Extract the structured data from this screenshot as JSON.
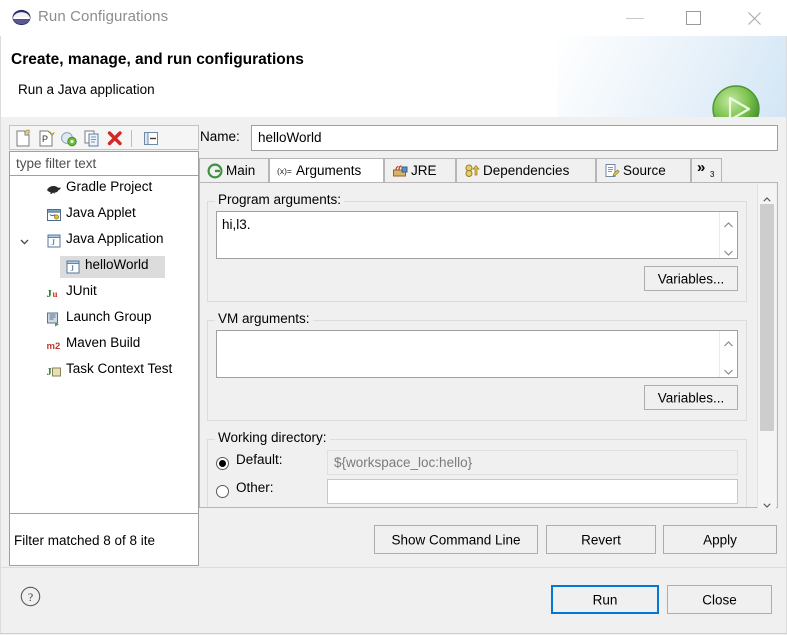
{
  "window": {
    "title": "Run Configurations",
    "app_icon": "eclipse-icon",
    "controls": {
      "minimize": "minimize-icon",
      "maximize": "maximize-icon",
      "close": "close-icon"
    }
  },
  "header": {
    "title": "Create, manage, and run configurations",
    "subtitle": "Run a Java application",
    "banner_icon": "run-green-play-icon"
  },
  "left_panel": {
    "toolbar": [
      {
        "name": "new-launch-configuration",
        "icon": "new-file-icon"
      },
      {
        "name": "new-prototype",
        "icon": "new-prototype-icon"
      },
      {
        "name": "export",
        "icon": "export-icon"
      },
      {
        "name": "duplicate",
        "icon": "duplicate-icon"
      },
      {
        "name": "delete",
        "icon": "delete-red-x-icon"
      },
      {
        "name": "collapse-all",
        "icon": "collapse-all-icon"
      }
    ],
    "filter": {
      "placeholder": "type filter text",
      "value": ""
    },
    "tree": [
      {
        "label": "Gradle Project",
        "icon": "gradle-elephant-icon",
        "indent": 0,
        "twisty": "none",
        "selected": false
      },
      {
        "label": "Java Applet",
        "icon": "java-applet-icon",
        "indent": 0,
        "twisty": "none",
        "selected": false
      },
      {
        "label": "Java Application",
        "icon": "java-application-icon",
        "indent": 0,
        "twisty": "expanded",
        "selected": false
      },
      {
        "label": "helloWorld",
        "icon": "java-application-icon",
        "indent": 1,
        "twisty": "none",
        "selected": true
      },
      {
        "label": "JUnit",
        "icon": "junit-icon",
        "indent": 0,
        "twisty": "none",
        "selected": false
      },
      {
        "label": "Launch Group",
        "icon": "launch-group-icon",
        "indent": 0,
        "twisty": "none",
        "selected": false
      },
      {
        "label": "Maven Build",
        "icon": "maven-m2-icon",
        "indent": 0,
        "twisty": "none",
        "selected": false
      },
      {
        "label": "Task Context Test",
        "icon": "task-context-test-icon",
        "indent": 0,
        "twisty": "none",
        "selected": false
      }
    ],
    "status": "Filter matched 8 of 8 ite"
  },
  "right_panel": {
    "name_label": "Name:",
    "name_value": "helloWorld",
    "name_placeholder": "",
    "tabs": [
      {
        "label": "Main",
        "icon": "main-green-c-icon",
        "active": false
      },
      {
        "label": "Arguments",
        "icon": "arguments-icon",
        "active": true
      },
      {
        "label": "JRE",
        "icon": "jre-icon",
        "active": false
      },
      {
        "label": "Dependencies",
        "icon": "dependencies-icon",
        "active": false
      },
      {
        "label": "Source",
        "icon": "source-icon",
        "active": false
      }
    ],
    "tab_overflow": {
      "label": "»",
      "count": "3"
    },
    "arguments_tab": {
      "program_arguments": {
        "label": "Program arguments:",
        "value": "hi,l3.",
        "variables_button": "Variables..."
      },
      "vm_arguments": {
        "label": "VM arguments:",
        "value": "",
        "variables_button": "Variables..."
      },
      "working_directory": {
        "label": "Working directory:",
        "default_radio_label": "Default:",
        "default_value": "${workspace_loc:hello}",
        "default_selected": true,
        "other_radio_label": "Other:",
        "other_value": ""
      }
    },
    "action_buttons": {
      "show_command_line": "Show Command Line",
      "revert": "Revert",
      "apply": "Apply"
    }
  },
  "footer": {
    "help_icon": "help-question-icon",
    "run_button": "Run",
    "close_button": "Close"
  },
  "colors": {
    "accent_blue": "#0078d7",
    "run_green": "#6ab04a",
    "dialog_bg": "#f0f0f0",
    "field_bg": "#ffffff",
    "selection_bg": "#dcdcdc"
  }
}
